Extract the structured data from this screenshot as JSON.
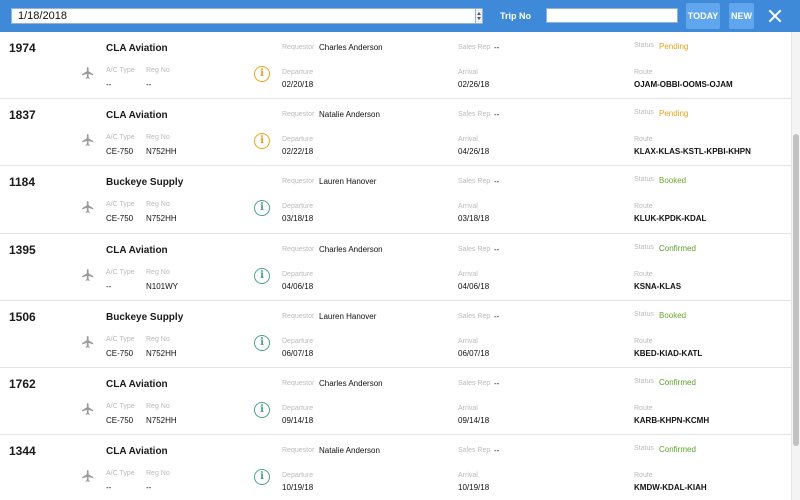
{
  "toolbar": {
    "date_value": "1/18/2018",
    "trip_no_label": "Trip No",
    "trip_no_value": "",
    "today_label": "TODAY",
    "new_label": "NEW",
    "close_icon": "close-icon"
  },
  "labels": {
    "requestor": "Requestor",
    "sales_rep": "Sales Rep",
    "status": "Status",
    "ac_type": "A/C Type",
    "reg_no": "Reg No",
    "departure": "Departure",
    "arrival": "Arrival",
    "route": "Route"
  },
  "colors": {
    "topbar": "#3e8ad9",
    "pending": "#e6a21a",
    "booked": "#6aab2e",
    "confirmed": "#5a9e2a",
    "info_pending": "#e6a21a",
    "info_other": "#4aa08e"
  },
  "trips": [
    {
      "trip_no": "1974",
      "client": "CLA Aviation",
      "requestor": "Charles Anderson",
      "sales_rep": "--",
      "status": "Pending",
      "ac_type": "--",
      "reg_no": "--",
      "departure": "02/20/18",
      "arrival": "02/26/18",
      "route": "OJAM-OBBI-OOMS-OJAM"
    },
    {
      "trip_no": "1837",
      "client": "CLA Aviation",
      "requestor": "Natalie Anderson",
      "sales_rep": "--",
      "status": "Pending",
      "ac_type": "CE-750",
      "reg_no": "N752HH",
      "departure": "02/22/18",
      "arrival": "04/26/18",
      "route": "KLAX-KLAS-KSTL-KPBI-KHPN"
    },
    {
      "trip_no": "1184",
      "client": "Buckeye Supply",
      "requestor": "Lauren Hanover",
      "sales_rep": "--",
      "status": "Booked",
      "ac_type": "CE-750",
      "reg_no": "N752HH",
      "departure": "03/18/18",
      "arrival": "03/18/18",
      "route": "KLUK-KPDK-KDAL"
    },
    {
      "trip_no": "1395",
      "client": "CLA Aviation",
      "requestor": "Charles Anderson",
      "sales_rep": "--",
      "status": "Confirmed",
      "ac_type": "--",
      "reg_no": "N101WY",
      "departure": "04/06/18",
      "arrival": "04/06/18",
      "route": "KSNA-KLAS"
    },
    {
      "trip_no": "1506",
      "client": "Buckeye Supply",
      "requestor": "Lauren Hanover",
      "sales_rep": "--",
      "status": "Booked",
      "ac_type": "CE-750",
      "reg_no": "N752HH",
      "departure": "06/07/18",
      "arrival": "06/07/18",
      "route": "KBED-KIAD-KATL"
    },
    {
      "trip_no": "1762",
      "client": "CLA Aviation",
      "requestor": "Charles Anderson",
      "sales_rep": "--",
      "status": "Confirmed",
      "ac_type": "CE-750",
      "reg_no": "N752HH",
      "departure": "09/14/18",
      "arrival": "09/14/18",
      "route": "KARB-KHPN-KCMH"
    },
    {
      "trip_no": "1344",
      "client": "CLA Aviation",
      "requestor": "Natalie Anderson",
      "sales_rep": "--",
      "status": "Confirmed",
      "ac_type": "--",
      "reg_no": "--",
      "departure": "10/19/18",
      "arrival": "10/19/18",
      "route": "KMDW-KDAL-KIAH"
    }
  ]
}
